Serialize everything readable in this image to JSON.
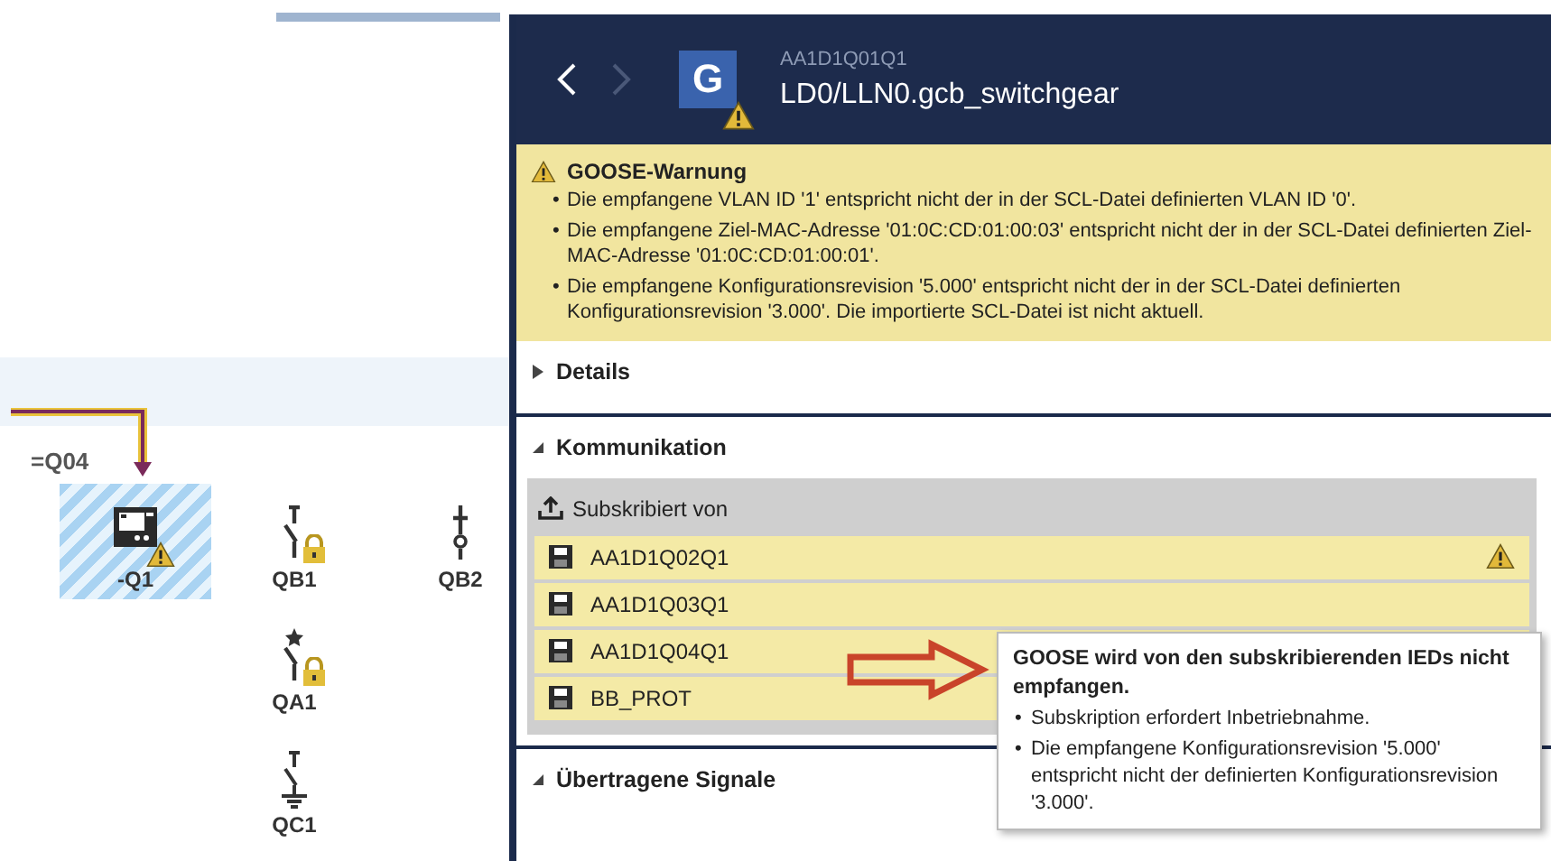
{
  "diagram": {
    "bay_label": "=Q04",
    "devices": [
      {
        "label": "-Q1",
        "kind": "ied",
        "selected": true,
        "warning": true,
        "locked": false
      },
      {
        "label": "QB1",
        "kind": "disconnector",
        "selected": false,
        "warning": false,
        "locked": true
      },
      {
        "label": "QB2",
        "kind": "truck",
        "selected": false,
        "warning": false,
        "locked": false
      },
      {
        "label": "QA1",
        "kind": "breaker",
        "selected": false,
        "warning": false,
        "locked": true
      },
      {
        "label": "QC1",
        "kind": "earth",
        "selected": false,
        "warning": false,
        "locked": false
      }
    ]
  },
  "panel": {
    "subtitle": "AA1D1Q01Q1",
    "title": "LD0/LLN0.gcb_switchgear",
    "icon_letter": "G",
    "header_warning": true,
    "warning": {
      "title": "GOOSE-Warnung",
      "bullet": "•",
      "items": [
        "Die empfangene VLAN ID '1' entspricht nicht der in der SCL-Datei definierten VLAN ID '0'.",
        "Die empfangene Ziel-MAC-Adresse '01:0C:CD:01:00:03' entspricht nicht der in der SCL-Datei definierten Ziel-MAC-Adresse '01:0C:CD:01:00:01'.",
        "Die empfangene Konfigurationsrevision '5.000' entspricht nicht der in der SCL-Datei definierten Konfigurationsrevision '3.000'. Die importierte SCL-Datei ist nicht aktuell."
      ]
    },
    "sections": [
      {
        "label": "Details",
        "expanded": false
      },
      {
        "label": "Kommunikation",
        "expanded": true,
        "subscribed": {
          "label": "Subskribiert von",
          "items": [
            {
              "name": "AA1D1Q02Q1",
              "warning": true
            },
            {
              "name": "AA1D1Q03Q1",
              "warning": false
            },
            {
              "name": "AA1D1Q04Q1",
              "warning": false
            },
            {
              "name": "BB_PROT",
              "warning": false
            }
          ]
        }
      },
      {
        "label": "Übertragene Signale",
        "expanded": true
      }
    ],
    "tooltip": {
      "title": "GOOSE wird von den subskribierenden IEDs nicht empfangen.",
      "bullet": "•",
      "items": [
        "Subskription erfordert Inbetriebnahme.",
        "Die empfangene Konfigurationsrevision '5.000' entspricht nicht der definierten Konfigurationsrevision '3.000'."
      ]
    }
  }
}
